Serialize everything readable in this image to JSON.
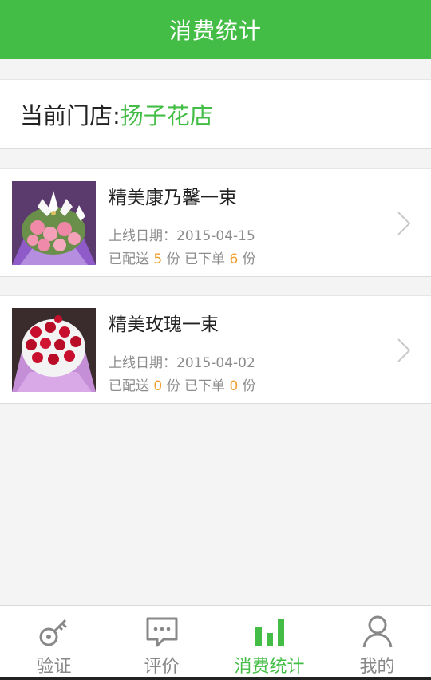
{
  "header": {
    "title": "消费统计"
  },
  "store": {
    "label": "当前门店:",
    "name": "扬子花店"
  },
  "products": [
    {
      "name": "精美康乃馨一束",
      "date_label": "上线日期：",
      "date": "2015-04-15",
      "delivered_prefix": "已配送 ",
      "delivered": "5",
      "delivered_unit": " 份 ",
      "ordered_prefix": "已下单 ",
      "ordered": "6",
      "ordered_unit": " 份",
      "image_icon": "carnation-bouquet-image"
    },
    {
      "name": "精美玫瑰一束",
      "date_label": "上线日期：",
      "date": "2015-04-02",
      "delivered_prefix": "已配送 ",
      "delivered": "0",
      "delivered_unit": " 份 ",
      "ordered_prefix": "已下单 ",
      "ordered": "0",
      "ordered_unit": " 份",
      "image_icon": "rose-bouquet-image"
    }
  ],
  "nav": {
    "tabs": [
      {
        "label": "验证",
        "icon": "key-icon",
        "active": false
      },
      {
        "label": "评价",
        "icon": "chat-bubble-icon",
        "active": false
      },
      {
        "label": "消费统计",
        "icon": "bar-chart-icon",
        "active": true
      },
      {
        "label": "我的",
        "icon": "user-icon",
        "active": false
      }
    ]
  },
  "colors": {
    "brand": "#43bd45",
    "count_highlight": "#f0a030",
    "muted_text": "#8c8c8c"
  }
}
